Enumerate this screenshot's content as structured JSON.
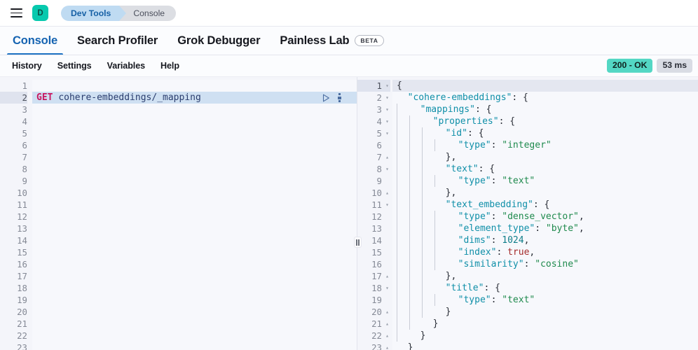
{
  "chrome": {
    "menu_icon": "hamburger-icon",
    "space_avatar": "D",
    "breadcrumbs": [
      {
        "label": "Dev Tools",
        "color": "#bfdbf2"
      },
      {
        "label": "Console",
        "color": "#dcdee3"
      }
    ]
  },
  "tabs": [
    {
      "label": "Console",
      "active": true,
      "badge": ""
    },
    {
      "label": "Search Profiler",
      "active": false,
      "badge": ""
    },
    {
      "label": "Grok Debugger",
      "active": false,
      "badge": ""
    },
    {
      "label": "Painless Lab",
      "active": false,
      "badge": "BETA"
    }
  ],
  "subnav": {
    "items": [
      "History",
      "Settings",
      "Variables",
      "Help"
    ],
    "status": {
      "code": "200 - OK",
      "color": "#53d7c4"
    },
    "time": {
      "value": "53 ms",
      "color": "#d9dce4"
    }
  },
  "request_editor": {
    "total_lines": 23,
    "highlighted_line": 2,
    "request": {
      "method": "GET",
      "path": "cohere-embeddings/_mapping"
    },
    "actions": {
      "send": "play-icon",
      "menu": "wrench-icon"
    }
  },
  "response_editor": {
    "total_lines": 23,
    "highlighted_line": 1,
    "lines": [
      {
        "n": 1,
        "fold": "open",
        "indent": 0,
        "text": "{"
      },
      {
        "n": 2,
        "fold": "open",
        "indent": 0,
        "text": "  \"cohere-embeddings\": {"
      },
      {
        "n": 3,
        "fold": "open",
        "indent": 1,
        "text": "    \"mappings\": {"
      },
      {
        "n": 4,
        "fold": "open",
        "indent": 2,
        "text": "      \"properties\": {"
      },
      {
        "n": 5,
        "fold": "open",
        "indent": 3,
        "text": "        \"id\": {"
      },
      {
        "n": 6,
        "fold": "none",
        "indent": 4,
        "text": "          \"type\": \"integer\""
      },
      {
        "n": 7,
        "fold": "close",
        "indent": 3,
        "text": "        },"
      },
      {
        "n": 8,
        "fold": "open",
        "indent": 3,
        "text": "        \"text\": {"
      },
      {
        "n": 9,
        "fold": "none",
        "indent": 4,
        "text": "          \"type\": \"text\""
      },
      {
        "n": 10,
        "fold": "close",
        "indent": 3,
        "text": "        },"
      },
      {
        "n": 11,
        "fold": "open",
        "indent": 3,
        "text": "        \"text_embedding\": {"
      },
      {
        "n": 12,
        "fold": "none",
        "indent": 4,
        "text": "          \"type\": \"dense_vector\","
      },
      {
        "n": 13,
        "fold": "none",
        "indent": 4,
        "text": "          \"element_type\": \"byte\","
      },
      {
        "n": 14,
        "fold": "none",
        "indent": 4,
        "text": "          \"dims\": 1024,"
      },
      {
        "n": 15,
        "fold": "none",
        "indent": 4,
        "text": "          \"index\": true,"
      },
      {
        "n": 16,
        "fold": "none",
        "indent": 4,
        "text": "          \"similarity\": \"cosine\""
      },
      {
        "n": 17,
        "fold": "close",
        "indent": 3,
        "text": "        },"
      },
      {
        "n": 18,
        "fold": "open",
        "indent": 3,
        "text": "        \"title\": {"
      },
      {
        "n": 19,
        "fold": "none",
        "indent": 4,
        "text": "          \"type\": \"text\""
      },
      {
        "n": 20,
        "fold": "close",
        "indent": 3,
        "text": "        }"
      },
      {
        "n": 21,
        "fold": "close",
        "indent": 2,
        "text": "      }"
      },
      {
        "n": 22,
        "fold": "close",
        "indent": 1,
        "text": "    }"
      },
      {
        "n": 23,
        "fold": "close",
        "indent": 0,
        "text": "  }"
      }
    ]
  },
  "splitter": {
    "name": "pane-resize-handle"
  }
}
